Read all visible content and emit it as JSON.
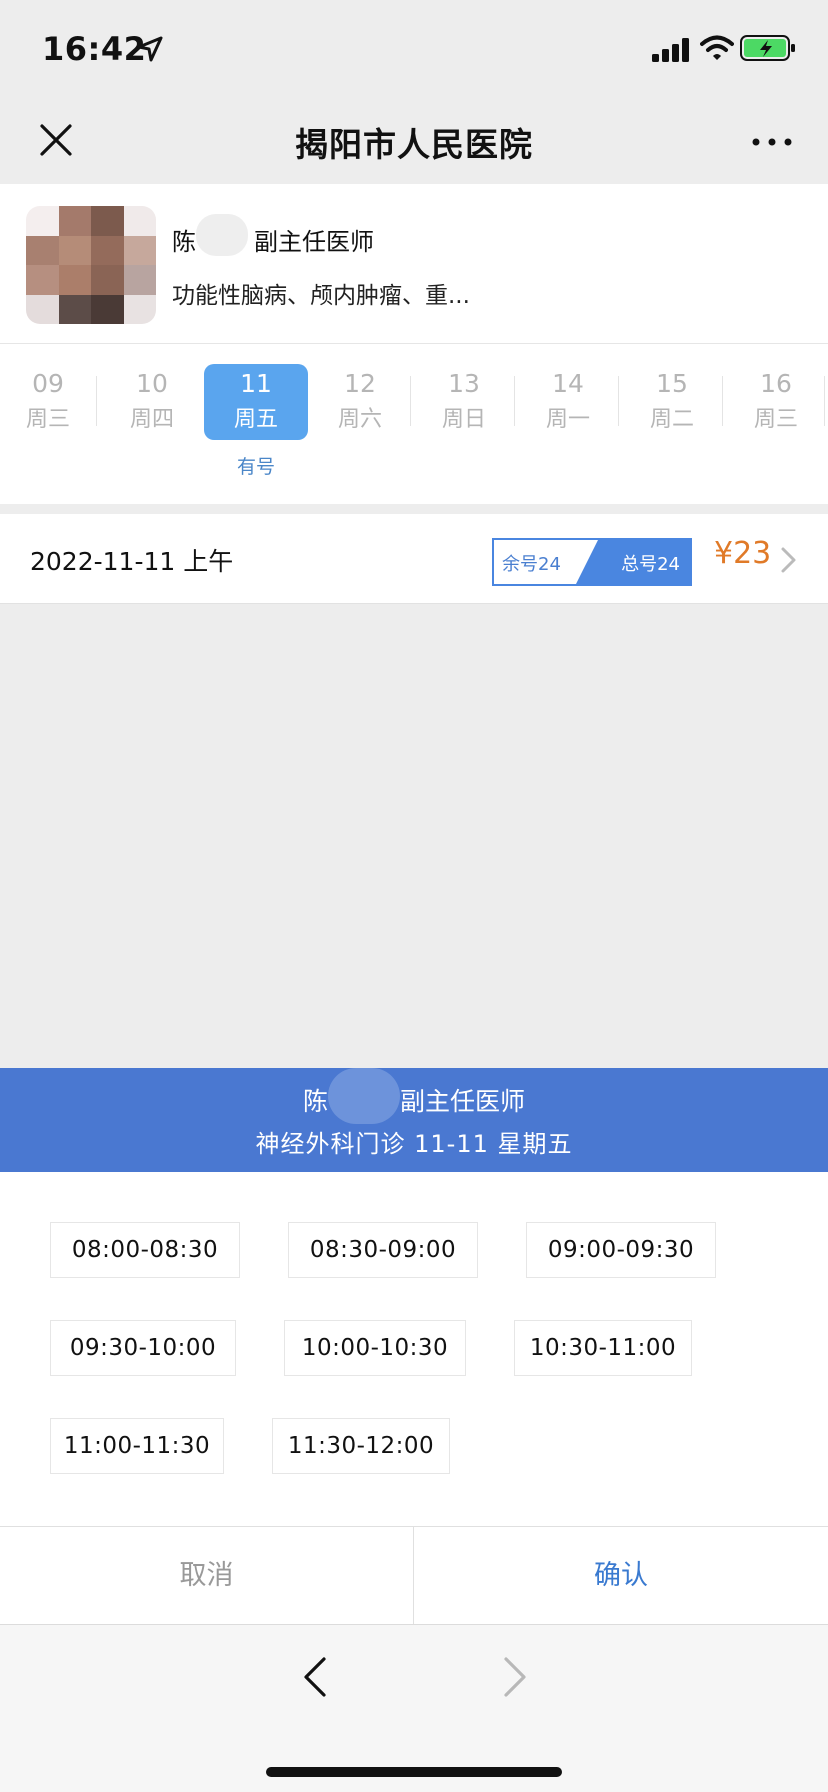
{
  "status_bar": {
    "time": "16:42"
  },
  "nav": {
    "title": "揭阳市人民医院"
  },
  "doctor": {
    "surname": "陈",
    "title": "副主任医师",
    "specialty": "功能性脑病、颅内肿瘤、重..."
  },
  "dates": [
    {
      "day": "09",
      "weekday": "周三"
    },
    {
      "day": "10",
      "weekday": "周四"
    },
    {
      "day": "11",
      "weekday": "周五",
      "selected": true
    },
    {
      "day": "12",
      "weekday": "周六"
    },
    {
      "day": "13",
      "weekday": "周日"
    },
    {
      "day": "14",
      "weekday": "周一"
    },
    {
      "day": "15",
      "weekday": "周二"
    },
    {
      "day": "16",
      "weekday": "周三"
    }
  ],
  "selected_date_status": "有号",
  "schedule": {
    "date": "2022-11-11 上午",
    "remaining": "余号24",
    "total": "总号24",
    "price": "¥23"
  },
  "sheet": {
    "surname": "陈",
    "title": "副主任医师",
    "info": "神经外科门诊  11-11  星期五"
  },
  "slots": [
    "08:00-08:30",
    "08:30-09:00",
    "09:00-09:30",
    "09:30-10:00",
    "10:00-10:30",
    "10:30-11:00",
    "11:00-11:30",
    "11:30-12:00"
  ],
  "actions": {
    "cancel": "取消",
    "confirm": "确认"
  },
  "colors": {
    "accent": "#4a78d1",
    "selected_date": "#5aa5ee",
    "price": "#e07a28",
    "confirm": "#3a7ad0"
  }
}
